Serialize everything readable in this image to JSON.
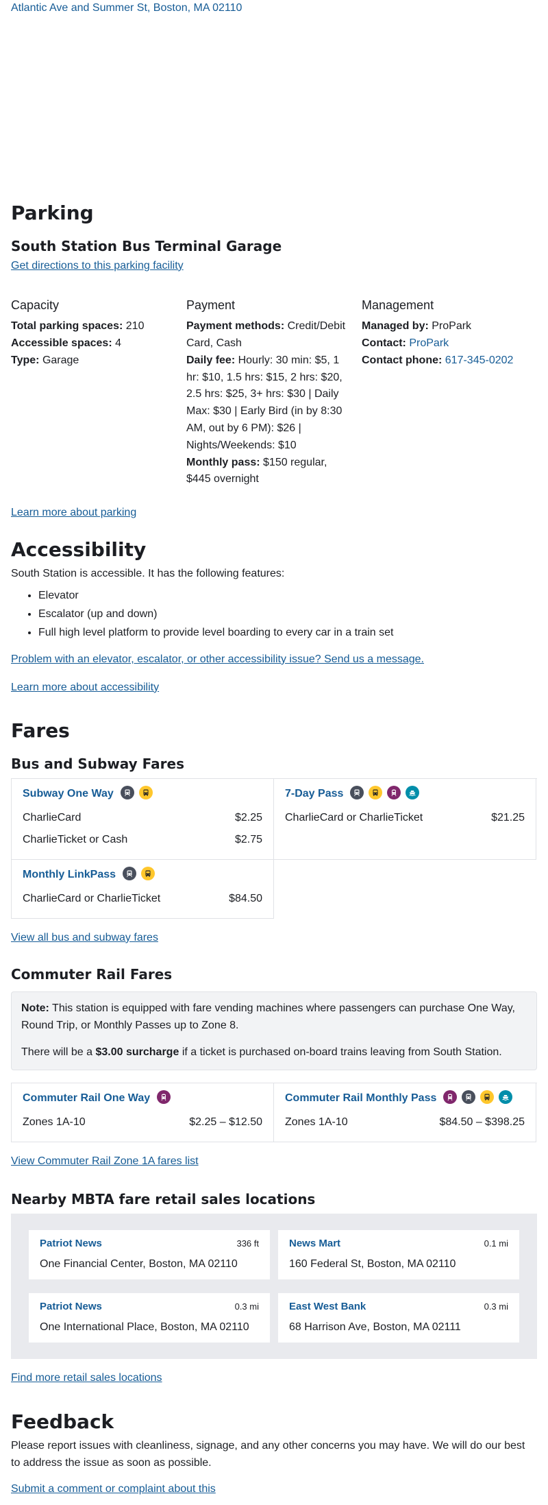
{
  "top_address": "Atlantic Ave and Summer St, Boston, MA 02110",
  "parking": {
    "heading": "Parking",
    "facility": "South Station Bus Terminal Garage",
    "directions_link": "Get directions to this parking facility",
    "capacity": {
      "heading": "Capacity",
      "total_label": "Total parking spaces:",
      "total_value": "210",
      "accessible_label": "Accessible spaces:",
      "accessible_value": "4",
      "type_label": "Type:",
      "type_value": "Garage"
    },
    "payment": {
      "heading": "Payment",
      "methods_label": "Payment methods:",
      "methods_value": "Credit/Debit Card, Cash",
      "daily_label": "Daily fee:",
      "daily_value": "Hourly: 30 min: $5, 1 hr: $10, 1.5 hrs: $15, 2 hrs: $20, 2.5 hrs: $25, 3+ hrs: $30 | Daily Max: $30 | Early Bird (in by 8:30 AM, out by 6 PM): $26 | Nights/Weekends: $10",
      "monthly_label": "Monthly pass:",
      "monthly_value": "$150 regular, $445 overnight"
    },
    "management": {
      "heading": "Management",
      "managed_label": "Managed by:",
      "managed_value": "ProPark",
      "contact_label": "Contact:",
      "contact_value": "ProPark",
      "phone_label": "Contact phone:",
      "phone_value": "617-345-0202"
    },
    "learn_more": "Learn more about parking"
  },
  "accessibility": {
    "heading": "Accessibility",
    "intro": "South Station is accessible. It has the following features:",
    "features": [
      "Elevator",
      "Escalator (up and down)",
      "Full high level platform to provide level boarding to every car in a train set"
    ],
    "problem_link": "Problem with an elevator, escalator, or other accessibility issue? Send us a message.",
    "learn_more": "Learn more about accessibility"
  },
  "fares": {
    "heading": "Fares",
    "bus_subway": {
      "heading": "Bus and Subway Fares",
      "cards": [
        {
          "title": "Subway One Way",
          "modes": [
            "subway",
            "bus"
          ],
          "rows": [
            {
              "label": "CharlieCard",
              "price": "$2.25"
            },
            {
              "label": "CharlieTicket or Cash",
              "price": "$2.75"
            }
          ]
        },
        {
          "title": "7-Day Pass",
          "modes": [
            "subway",
            "bus",
            "commuter-rail",
            "ferry"
          ],
          "rows": [
            {
              "label": "CharlieCard or CharlieTicket",
              "price": "$21.25"
            }
          ]
        },
        {
          "title": "Monthly LinkPass",
          "modes": [
            "subway",
            "bus"
          ],
          "rows": [
            {
              "label": "CharlieCard or CharlieTicket",
              "price": "$84.50"
            }
          ]
        }
      ],
      "view_all": "View all bus and subway fares"
    },
    "commuter_rail": {
      "heading": "Commuter Rail Fares",
      "note_label": "Note:",
      "note_text": "This station is equipped with fare vending machines where passengers can purchase One Way, Round Trip, or Monthly Passes up to Zone 8.",
      "surcharge_pre": "There will be a",
      "surcharge_amount": "$3.00 surcharge",
      "surcharge_post": "if a ticket is purchased on-board trains leaving from South Station.",
      "cards": [
        {
          "title": "Commuter Rail One Way",
          "modes": [
            "commuter-rail"
          ],
          "rows": [
            {
              "label": "Zones 1A-10",
              "price": "$2.25 – $12.50"
            }
          ]
        },
        {
          "title": "Commuter Rail Monthly Pass",
          "modes": [
            "commuter-rail",
            "subway",
            "bus",
            "ferry"
          ],
          "rows": [
            {
              "label": "Zones 1A-10",
              "price": "$84.50 – $398.25"
            }
          ]
        }
      ],
      "view_zone": "View Commuter Rail Zone 1A fares list"
    }
  },
  "retail": {
    "heading": "Nearby MBTA fare retail sales locations",
    "locations": [
      {
        "name": "Patriot News",
        "distance": "336 ft",
        "address": "One Financial Center, Boston, MA 02110"
      },
      {
        "name": "News Mart",
        "distance": "0.1 mi",
        "address": "160 Federal St, Boston, MA 02110"
      },
      {
        "name": "Patriot News",
        "distance": "0.3 mi",
        "address": "One International Place, Boston, MA 02110"
      },
      {
        "name": "East West Bank",
        "distance": "0.3 mi",
        "address": "68 Harrison Ave, Boston, MA 02111"
      }
    ],
    "find_more": "Find more retail sales locations"
  },
  "feedback": {
    "heading": "Feedback",
    "text": "Please report issues with cleanliness, signage, and any other concerns you may have. We will do our best to address the issue as soon as possible.",
    "submit_link": "Submit a comment or complaint about this"
  },
  "mode_colors": {
    "subway": "#494f5c",
    "bus": "#ffc72c",
    "commuter-rail": "#80276c",
    "ferry": "#008eaa"
  }
}
